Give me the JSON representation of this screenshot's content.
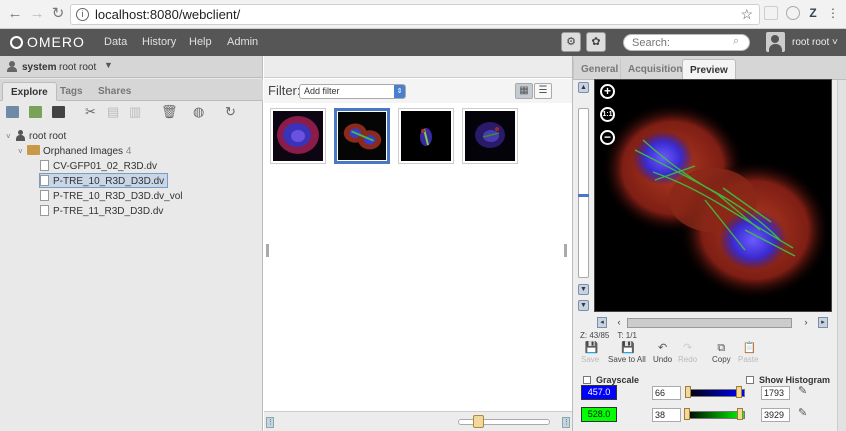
{
  "browser": {
    "url": "localhost:8080/webclient/",
    "back_icon": "←",
    "forward_icon": "→",
    "reload_icon": "↻",
    "info_icon": "i",
    "star_icon": "☆",
    "menu_icon": "⋮",
    "ext_z": "Z"
  },
  "header": {
    "logo": "OMERO",
    "menu": [
      "Data",
      "History",
      "Help",
      "Admin"
    ],
    "search_placeholder": "Search:",
    "user_menu": "root root ˅"
  },
  "left": {
    "group": "system",
    "user": "root root",
    "tabs": [
      "Explore",
      "Tags",
      "Shares"
    ],
    "tree": {
      "root_user": "root root",
      "folder": "Orphaned Images",
      "folder_count": "4",
      "images": [
        "CV-GFP01_02_R3D.dv",
        "P-TRE_10_R3D_D3D.dv",
        "P-TRE_10_R3D_D3D.dv_vol",
        "P-TRE_11_R3D_D3D.dv"
      ],
      "selected_index": 1
    }
  },
  "center": {
    "filter_label": "Filter:",
    "filter_select": "Add filter",
    "thumbnail_count": 4,
    "selected_thumbnail": 1
  },
  "right": {
    "tabs": [
      "General",
      "Acquisition",
      "Preview"
    ],
    "active_tab": "Preview",
    "zoom_in": "+",
    "zoom_reset": "1:1",
    "zoom_out": "−",
    "z_label": "Z: 43/85",
    "t_label": "T: 1/1",
    "actions": [
      {
        "label": "Save",
        "icon": "💾",
        "enabled": false
      },
      {
        "label": "Save to All",
        "icon": "💾",
        "enabled": true
      },
      {
        "label": "Undo",
        "icon": "↶",
        "enabled": true
      },
      {
        "label": "Redo",
        "icon": "↷",
        "enabled": false
      },
      {
        "label": "Copy",
        "icon": "⧉",
        "enabled": true
      },
      {
        "label": "Paste",
        "icon": "📋",
        "enabled": false
      }
    ],
    "grayscale_label": "Grayscale",
    "histogram_label": "Show Histogram",
    "channels": [
      {
        "wavelength": "457.0",
        "color": "#0000ff",
        "start": "66",
        "end": "1793",
        "start_fraction": 0.03,
        "end_fraction": 0.9
      },
      {
        "wavelength": "528.0",
        "color": "#00ff00",
        "start": "38",
        "end": "3929",
        "start_fraction": 0.01,
        "end_fraction": 0.92
      }
    ]
  }
}
